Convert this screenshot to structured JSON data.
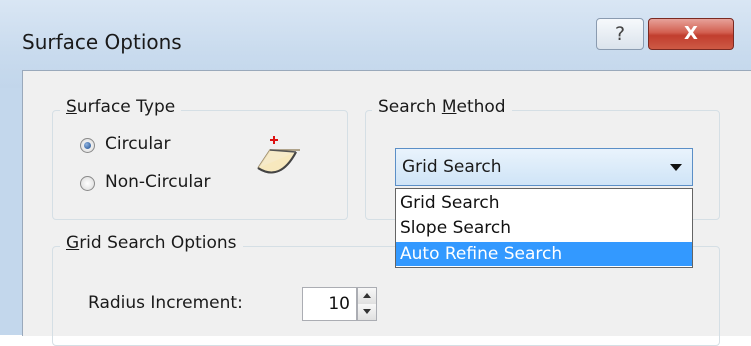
{
  "window": {
    "title": "Surface Options",
    "help_label": "?",
    "close_label": "X"
  },
  "surface_type": {
    "legend_prefix": "S",
    "legend_rest": "urface Type",
    "options": [
      {
        "label": "Circular",
        "checked": true
      },
      {
        "label": "Non-Circular",
        "checked": false
      }
    ],
    "icon": "circular-slip-surface-icon"
  },
  "search_method": {
    "legend_prefix": "Search ",
    "legend_underline": "M",
    "legend_rest": "ethod",
    "selected": "Grid Search",
    "options": [
      "Grid Search",
      "Slope Search",
      "Auto Refine Search"
    ],
    "highlighted": "Auto Refine Search"
  },
  "grid_search_options": {
    "legend_prefix": "G",
    "legend_rest": "rid Search Options",
    "radius_increment_label": "Radius Increment:",
    "radius_increment_value": "10"
  }
}
